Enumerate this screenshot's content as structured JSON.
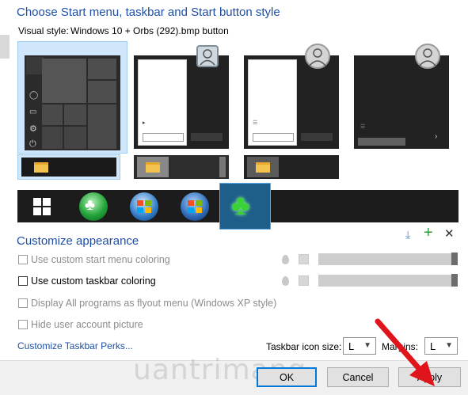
{
  "header": {
    "title": "Choose Start menu, taskbar and Start button style",
    "visual_style_label": "Visual style:",
    "visual_style_value": "Windows 10 + Orbs (292).bmp button"
  },
  "appearance": {
    "title": "Customize appearance",
    "options": [
      {
        "label": "Use custom start menu coloring",
        "enabled": false
      },
      {
        "label": "Use custom taskbar coloring",
        "enabled": true
      },
      {
        "label": "Display All programs as flyout menu (Windows XP style)",
        "enabled": false
      },
      {
        "label": "Hide user account picture",
        "enabled": false
      }
    ],
    "link": "Customize Taskbar Perks..."
  },
  "icon_size": {
    "label": "Taskbar icon size:",
    "value": "L"
  },
  "margins": {
    "label": "Margins:",
    "value": "L"
  },
  "buttons": {
    "ok": "OK",
    "cancel": "Cancel",
    "apply": "Apply"
  },
  "watermark": "uantrimang",
  "colors": {
    "accent_blue": "#1e4fa5",
    "default_button_border": "#0078d7",
    "arrow_red": "#e0151b",
    "selection": "#cfe6fb"
  },
  "icons": [
    "download-icon",
    "plus-icon",
    "close-icon",
    "color-drop-icon",
    "folder-icon",
    "windows-logo-icon",
    "user-icon",
    "shamrock-icon"
  ]
}
